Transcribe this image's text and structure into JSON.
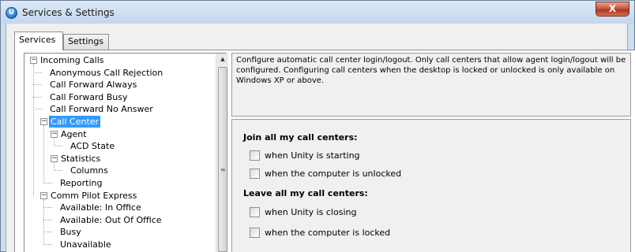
{
  "window": {
    "title": "Services & Settings",
    "icon_letter": "U",
    "close_glyph": "X"
  },
  "tabs": [
    {
      "label": "Services",
      "active": true
    },
    {
      "label": "Settings",
      "active": false
    }
  ],
  "tree": {
    "items": [
      {
        "label": "Incoming Calls",
        "level": 0,
        "expander": "minus"
      },
      {
        "label": "Anonymous Call Rejection",
        "level": 1
      },
      {
        "label": "Call Forward Always",
        "level": 1
      },
      {
        "label": "Call Forward Busy",
        "level": 1
      },
      {
        "label": "Call Forward No Answer",
        "level": 1
      },
      {
        "label": "Call Center",
        "level": 1,
        "expander": "minus",
        "selected": true
      },
      {
        "label": "Agent",
        "level": 2,
        "expander": "minus"
      },
      {
        "label": "ACD State",
        "level": 3
      },
      {
        "label": "Statistics",
        "level": 2,
        "expander": "minus"
      },
      {
        "label": "Columns",
        "level": 3
      },
      {
        "label": "Reporting",
        "level": 2
      },
      {
        "label": "Comm Pilot Express",
        "level": 1,
        "expander": "minus"
      },
      {
        "label": "Available: In Office",
        "level": 2
      },
      {
        "label": "Available: Out Of Office",
        "level": 2
      },
      {
        "label": "Busy",
        "level": 2
      },
      {
        "label": "Unavailable",
        "level": 2
      }
    ]
  },
  "description": "Configure automatic call center login/logout.  Only call centers that allow agent login/logout will be configured.  Configuring call centers when the desktop is locked or unlocked is only available on Windows XP or above.",
  "join_section": {
    "heading": "Join all my call centers:",
    "options": [
      {
        "label": "when Unity is starting",
        "checked": false
      },
      {
        "label": "when the computer is unlocked",
        "checked": false
      }
    ]
  },
  "leave_section": {
    "heading": "Leave all my call centers:",
    "options": [
      {
        "label": "when Unity is closing",
        "checked": false
      },
      {
        "label": "when the computer is locked",
        "checked": false
      }
    ]
  },
  "colors": {
    "selection": "#3399ff",
    "title_bar": "#c3d6ed",
    "close_button": "#c75a45"
  }
}
